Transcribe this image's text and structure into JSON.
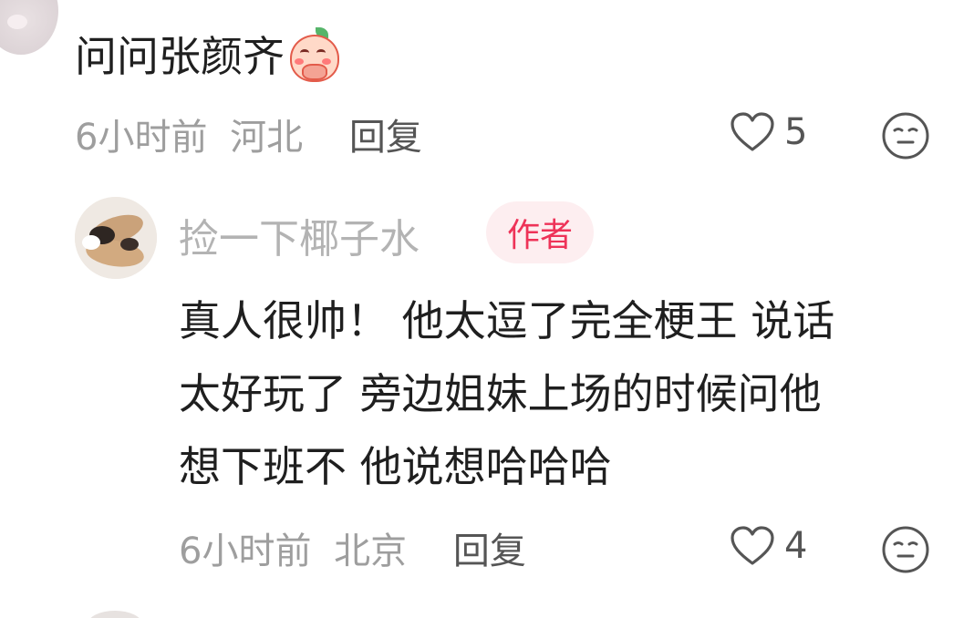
{
  "top_comment": {
    "text": "问问张颜齐",
    "emoji": "peach-praying-sticker",
    "time": "6小时前",
    "location": "河北",
    "reply_label": "回复",
    "likes": "5"
  },
  "reply_comment": {
    "username": "捡一下椰子水",
    "badge": "作者",
    "lines": [
      "真人很帅！ 他太逗了完全梗王 说话",
      "太好玩了 旁边姐妹上场的时候问他",
      "想下班不 他说想哈哈哈"
    ],
    "time": "6小时前",
    "location": "北京",
    "reply_label": "回复",
    "likes": "4"
  },
  "colors": {
    "badge_text": "#ee3358",
    "badge_bg": "#fdeef0",
    "meta_text": "#9e9e9e"
  }
}
